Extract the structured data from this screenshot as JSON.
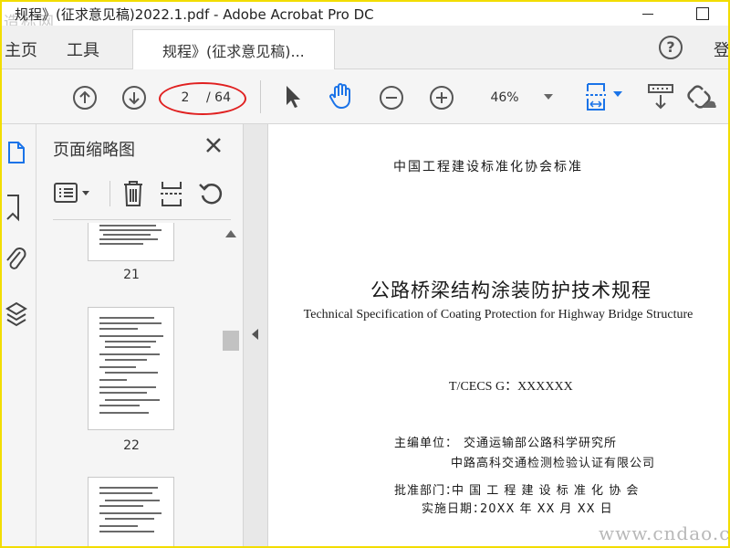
{
  "window": {
    "title": "规程》(征求意见稿)2022.1.pdf - Adobe Acrobat Pro DC",
    "watermark_top": "造标网"
  },
  "tabs": {
    "home": "主页",
    "tools": "工具",
    "document": "规程》(征求意见稿)...",
    "login": "登"
  },
  "toolbar": {
    "current_page": "2",
    "total_pages": "/ 64",
    "zoom": "46%",
    "icons": [
      "prev-page-icon",
      "next-page-icon",
      "select-arrow-icon",
      "hand-icon",
      "zoom-out-icon",
      "zoom-in-icon",
      "page-fit-icon",
      "scroll-mode-icon",
      "share-link-icon"
    ],
    "accent_color": "#1a73e8"
  },
  "thumb_panel": {
    "title": "页面缩略图",
    "thumbnails": [
      {
        "label": "21"
      },
      {
        "label": "22"
      },
      {
        "label": ""
      }
    ]
  },
  "document": {
    "header": "中国工程建设标准化协会标准",
    "title": "公路桥梁结构涂装防护技术规程",
    "subtitle": "Technical Specification of Coating Protection for Highway Bridge Structure",
    "code": "T/CECS G：XXXXXX",
    "chief_editor_label": "主编单位：",
    "chief_editor_1": "交通运输部公路科学研究所",
    "chief_editor_2": "中路高科交通检测检验认证有限公司",
    "approval_label": "批准部门：",
    "approval_value": "中 国 工 程 建 设 标 准 化 协 会",
    "effective_label": "实施日期：",
    "effective_value": "20XX 年 XX 月 XX 日"
  },
  "watermark_bottom": "www.cndao.com"
}
